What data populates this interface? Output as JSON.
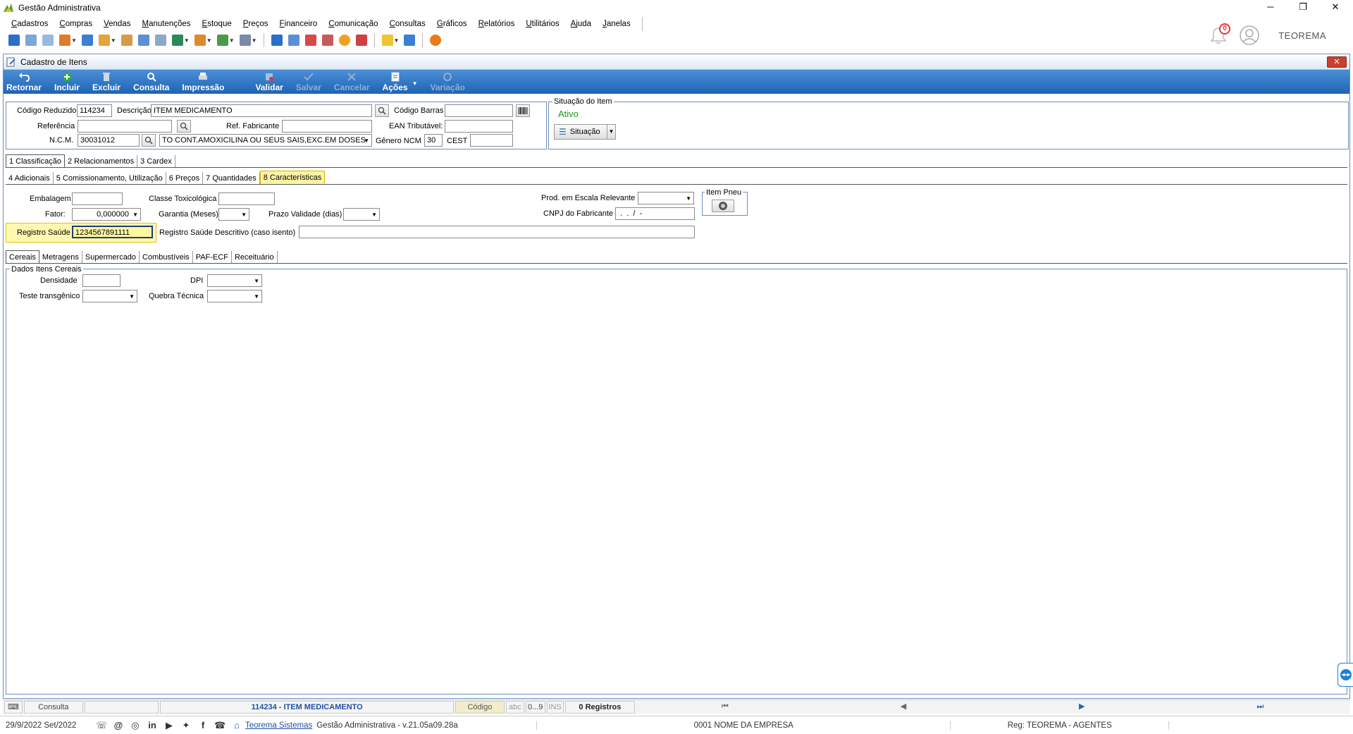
{
  "window": {
    "title": "Gestão Administrativa",
    "controls": [
      "─",
      "❐",
      "✕"
    ]
  },
  "menu": [
    "Cadastros",
    "Compras",
    "Vendas",
    "Manutenções",
    "Estoque",
    "Preços",
    "Financeiro",
    "Comunicação",
    "Consultas",
    "Gráficos",
    "Relatórios",
    "Utilitários",
    "Ajuda",
    "Janelas"
  ],
  "topright": {
    "notification_count": "0",
    "brand": "TEOREMA"
  },
  "inner": {
    "title": "Cadastro de Itens",
    "close": "✕",
    "actions": {
      "retornar": "Retornar",
      "incluir": "Incluir",
      "excluir": "Excluir",
      "consulta": "Consulta",
      "impressao": "Impressão",
      "validar": "Validar",
      "salvar": "Salvar",
      "cancelar": "Cancelar",
      "acoes": "Ações",
      "variacao": "Variação"
    }
  },
  "form": {
    "codigo_reduzido_label": "Código Reduzido",
    "codigo_reduzido": "114234",
    "descricao_label": "Descrição",
    "descricao": "ITEM MEDICAMENTO",
    "codigo_barras_label": "Código Barras",
    "codigo_barras": "",
    "referencia_label": "Referência",
    "referencia": "",
    "ref_fabricante_label": "Ref. Fabricante",
    "ref_fabricante": "",
    "ean_label": "EAN Tributável:",
    "ean": "",
    "ncm_label": "N.C.M.",
    "ncm": "30031012",
    "ncm_desc": "TO CONT.AMOXICILINA OU SEUS SAIS,EXC.EM DOSES",
    "genero_label": "Gênero NCM",
    "genero": "30",
    "cest_label": "CEST",
    "cest": ""
  },
  "situacao": {
    "group_title": "Situação do Item",
    "status": "Ativo",
    "button": "Situação"
  },
  "tabs1": [
    "1 Classificação",
    "2 Relacionamentos",
    "3 Cardex"
  ],
  "tabs2": [
    "4 Adicionais",
    "5 Comissionamento, Utilização",
    "6 Preços",
    "7 Quantidades",
    "8 Características"
  ],
  "caracteristicas": {
    "embalagem_label": "Embalagem",
    "embalagem": "",
    "classe_tox_label": "Classe Toxicológica",
    "classe_tox": "",
    "prod_escala_label": "Prod. em Escala Relevante",
    "prod_escala": "",
    "item_pneu_label": "Item Pneu",
    "fator_label": "Fator:",
    "fator": "0,000000",
    "garantia_label": "Garantia (Meses)",
    "garantia": "",
    "prazo_label": "Prazo Validade (dias)",
    "prazo": "",
    "cnpj_label": "CNPJ do Fabricante",
    "cnpj": " .  .  /  - ",
    "registro_label": "Registro Saúde",
    "registro": "1234567891111",
    "registro_desc_label": "Registro Saúde Descritivo (caso isento)",
    "registro_desc": ""
  },
  "tabs3": [
    "Cereais",
    "Metragens",
    "Supermercado",
    "Combustíveis",
    "PAF-ECF",
    "Receituário"
  ],
  "cereais": {
    "group_title": "Dados Itens Cereais",
    "densidade_label": "Densidade",
    "densidade": "",
    "dpi_label": "DPI",
    "dpi": "",
    "teste_label": "Teste transgênico",
    "teste": "",
    "quebra_label": "Quebra Técnica",
    "quebra": ""
  },
  "statusbar": {
    "mode": "Consulta",
    "current": "114234 - ITEM MEDICAMENTO",
    "order": "Código",
    "abc": "abc",
    "range": "0...9",
    "ins": "INS",
    "registros": "0 Registros",
    "nav_first": "⏮",
    "nav_prev": "◀",
    "nav_next": "▶",
    "nav_last": "⏭"
  },
  "footer": {
    "date": "29/9/2022 Set/2022",
    "company_link": "Teorema Sistemas",
    "version": "Gestão Administrativa - v.21.05a09.28a",
    "empresa": "0001 NOME DA EMPRESA",
    "reg": "Reg: TEOREMA - AGENTES"
  },
  "colors": {
    "accent": "#1f64b5",
    "highlight": "#fff9b0",
    "status_green": "#1a9a1a",
    "link_blue": "#1f4fa8"
  }
}
